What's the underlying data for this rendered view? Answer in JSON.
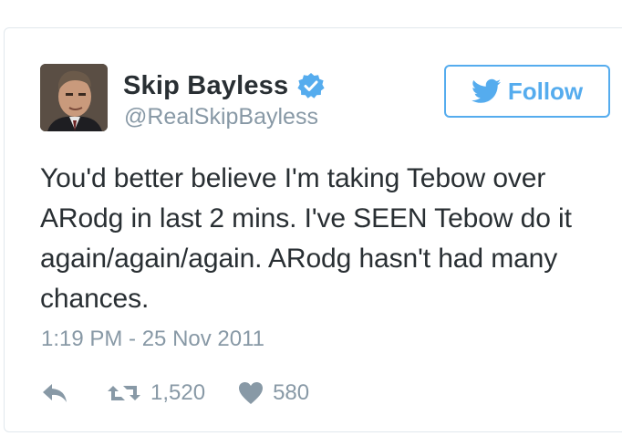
{
  "user": {
    "display_name": "Skip Bayless",
    "handle": "@RealSkipBayless",
    "verified": true
  },
  "follow_button": {
    "label": "Follow",
    "icon": "twitter-bird-icon"
  },
  "tweet": {
    "text": "You'd better believe I'm taking Tebow over ARodg in last 2 mins. I've SEEN Tebow do it again/again/again. ARodg hasn't had many chances.",
    "timestamp": "1:19 PM - 25 Nov 2011"
  },
  "actions": {
    "reply_icon": "reply-icon",
    "retweet_icon": "retweet-icon",
    "retweet_count": "1,520",
    "like_icon": "heart-icon",
    "like_count": "580"
  },
  "colors": {
    "accent": "#55acee",
    "text": "#292f33",
    "muted": "#8899a6",
    "border": "#e1e8ed"
  }
}
